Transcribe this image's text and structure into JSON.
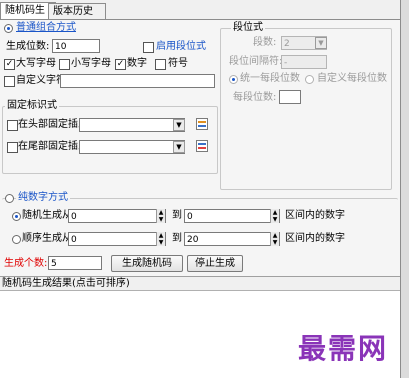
{
  "tabs": [
    {
      "label": "随机码生成"
    },
    {
      "label": "版本历史"
    }
  ],
  "mode_normal": {
    "label": "普通组合方式"
  },
  "length": {
    "label": "生成位数:",
    "value": "10"
  },
  "enable_segments": {
    "label": "启用段位式"
  },
  "charset": {
    "uppercase": "大写字母",
    "lowercase": "小写字母",
    "digits": "数字",
    "symbols": "符号",
    "custom": "自定义字符"
  },
  "segment": {
    "title": "段位式",
    "count_label": "段数:",
    "count_value": "2",
    "sep_label": "段位间隔符:",
    "sep_value": "-",
    "uniform_label": "统一每段位数",
    "custom_label": "自定义每段位数",
    "per_label": "每段位数:"
  },
  "fixed": {
    "title": "固定标识式",
    "head_label": "在头部固定插入",
    "tail_label": "在尾部固定插入"
  },
  "numeric": {
    "title": "纯数字方式",
    "random_label": "随机生成从",
    "seq_label": "顺序生成从",
    "to": "到",
    "range_label": "区间内的数字",
    "random_from": "0",
    "random_to": "0",
    "seq_from": "0",
    "seq_to": "20"
  },
  "count": {
    "label": "生成个数:",
    "value": "5"
  },
  "buttons": {
    "generate": "生成随机码",
    "stop": "停止生成"
  },
  "results": {
    "header": "随机码生成结果(点击可排序)"
  },
  "watermark": "最需网"
}
